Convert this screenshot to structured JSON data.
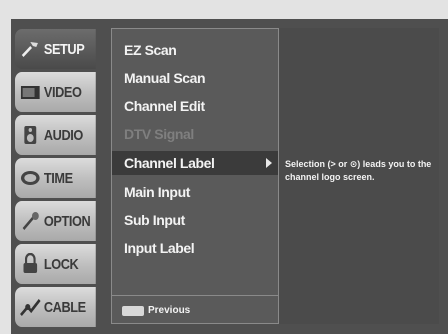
{
  "tabs": [
    {
      "label": "SETUP",
      "icon": "setup-icon",
      "active": true
    },
    {
      "label": "VIDEO",
      "icon": "video-icon",
      "active": false
    },
    {
      "label": "AUDIO",
      "icon": "audio-icon",
      "active": false
    },
    {
      "label": "TIME",
      "icon": "time-icon",
      "active": false
    },
    {
      "label": "OPTION",
      "icon": "option-icon",
      "active": false
    },
    {
      "label": "LOCK",
      "icon": "lock-icon",
      "active": false
    },
    {
      "label": "CABLE",
      "icon": "cable-icon",
      "active": false
    }
  ],
  "menu": {
    "items": [
      {
        "label": "EZ Scan"
      },
      {
        "label": "Manual Scan"
      },
      {
        "label": "Channel Edit"
      },
      {
        "label": "DTV Signal",
        "disabled": true
      },
      {
        "label": "Channel Label",
        "selected": true
      },
      {
        "label": "Main Input"
      },
      {
        "label": "Sub Input"
      },
      {
        "label": "Input Label"
      }
    ],
    "footer": {
      "key_icon": "menu-key-icon",
      "label": "Previous"
    }
  },
  "info": {
    "text": "Selection (> or ⊙) leads you to the channel logo screen."
  },
  "colors": {
    "frame": "#4f4f4f",
    "selected": "#3b3b3b",
    "tab": "#c4c4c4",
    "active_tab": "#555555"
  }
}
